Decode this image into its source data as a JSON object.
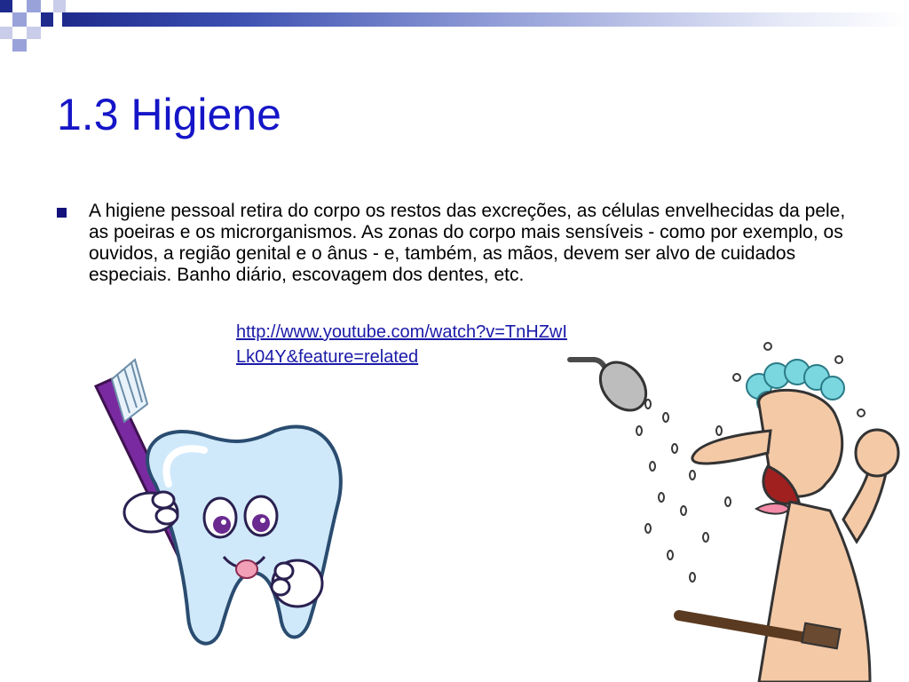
{
  "slide": {
    "title": "1.3 Higiene",
    "paragraph": "A higiene pessoal retira do corpo os restos  das excreções, as células envelhecidas da pele, as poeiras e os microrganismos. As zonas do corpo mais sensíveis - como por exemplo, os ouvidos, a região genital e o ânus - e, também, as mãos, devem ser alvo de cuidados especiais. Banho diário, escovagem dos dentes, etc.",
    "link_line1": "http://www.youtube.com/watch?v=TnHZwI",
    "link_line2": "Lk04Y&feature=related"
  },
  "colors": {
    "title": "#1515c8",
    "bullet": "#12127a",
    "link": "#1a1aa8",
    "decoration": "#1e2a8c"
  }
}
